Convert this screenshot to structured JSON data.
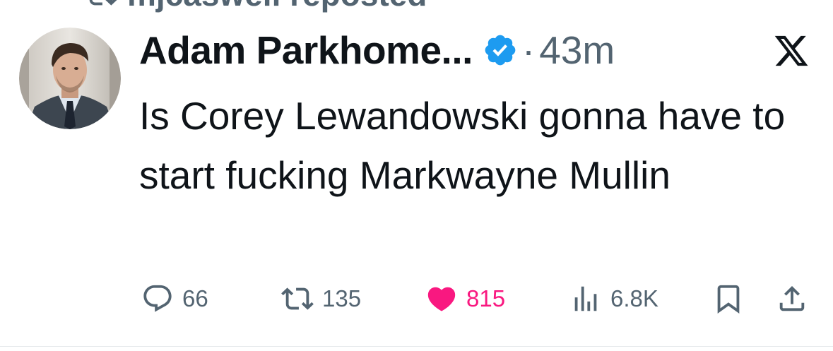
{
  "repost": {
    "text": "mjcaswell reposted"
  },
  "author": {
    "display_name": "Adam Parkhome...",
    "separator": "·",
    "time_ago": "43m"
  },
  "tweet": {
    "text": "Is Corey Lewandowski gonna have to start fucking Markwayne Mullin"
  },
  "actions": {
    "replies": "66",
    "reposts": "135",
    "likes": "815",
    "views": "6.8K"
  },
  "colors": {
    "verified_blue": "#1d9bf0",
    "like_pink": "#f91880",
    "secondary_text": "#536471",
    "primary_text": "#0f1419"
  },
  "icons": {
    "repost": "repost-icon",
    "verified": "verified-badge-icon",
    "platform": "x-logo-icon",
    "reply": "reply-icon",
    "retweet": "retweet-icon",
    "like": "heart-icon",
    "views": "views-icon",
    "bookmark": "bookmark-icon",
    "share": "share-icon"
  }
}
